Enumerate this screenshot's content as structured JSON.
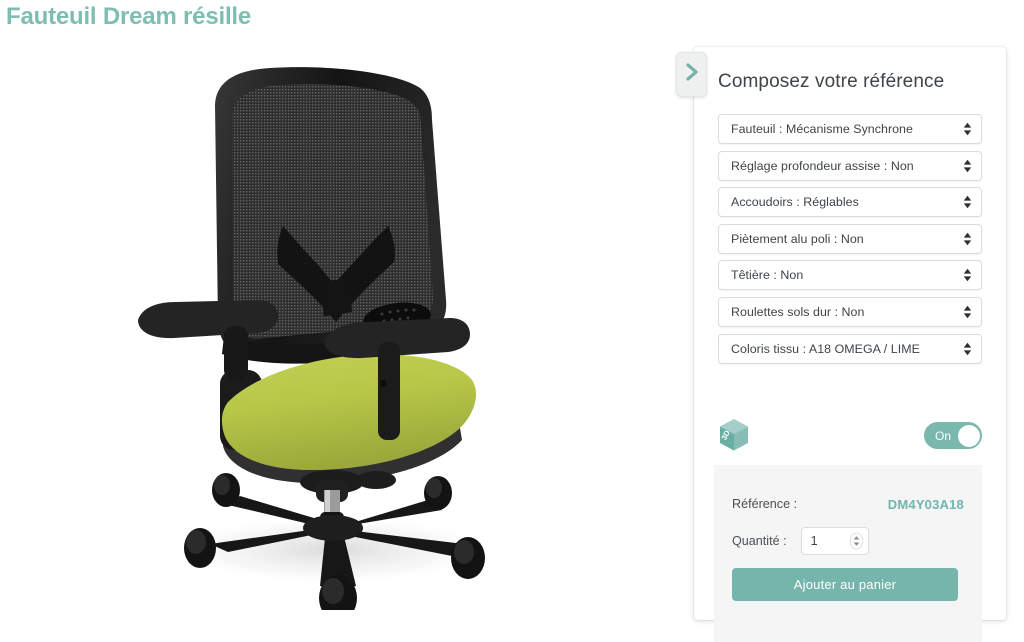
{
  "page": {
    "title": "Fauteuil Dream résille",
    "title_color": "#7fbdb3",
    "background": "#ffffff"
  },
  "product_image": {
    "alt": "Fauteuil Dream résille - dossier résille noir, assise tissu lime",
    "frame_color": "#1c1c1c",
    "seat_color": "#b8c748",
    "mesh_color": "#2b2b2b"
  },
  "panel": {
    "toggle_tab_icon": "chevron-right-icon",
    "toggle_tab_color": "#7ab7ad",
    "title": "Composez votre référence",
    "options": [
      {
        "label": "Fauteuil : Mécanisme Synchrone",
        "name": "fauteuil",
        "value": "Mécanisme Synchrone"
      },
      {
        "label": "Réglage profondeur assise : Non",
        "name": "reglage-profondeur-assise",
        "value": "Non"
      },
      {
        "label": "Accoudoirs : Réglables",
        "name": "accoudoirs",
        "value": "Réglables"
      },
      {
        "label": "Piètement alu poli : Non",
        "name": "pietement-alu-poli",
        "value": "Non"
      },
      {
        "label": "Têtière : Non",
        "name": "tetiere",
        "value": "Non"
      },
      {
        "label": "Roulettes sols dur : Non",
        "name": "roulettes-sols-dur",
        "value": "Non"
      },
      {
        "label": "Coloris tissu : A18 OMEGA / LIME",
        "name": "coloris-tissu",
        "value": "A18 OMEGA / LIME"
      }
    ],
    "three_d": {
      "icon": "cube-3d-icon",
      "icon_label": "3D",
      "icon_color": "#7ab7ad",
      "toggle_state": "On",
      "toggle_color": "#7ab7ad"
    },
    "summary": {
      "reference_label": "Référence :",
      "reference_value": "DM4Y03A18",
      "reference_color": "#6fb6ab",
      "quantity_label": "Quantité :",
      "quantity_value": "1",
      "add_to_cart_label": "Ajouter au panier",
      "add_to_cart_color": "#76b5ab",
      "background": "#f5f5f5"
    }
  }
}
